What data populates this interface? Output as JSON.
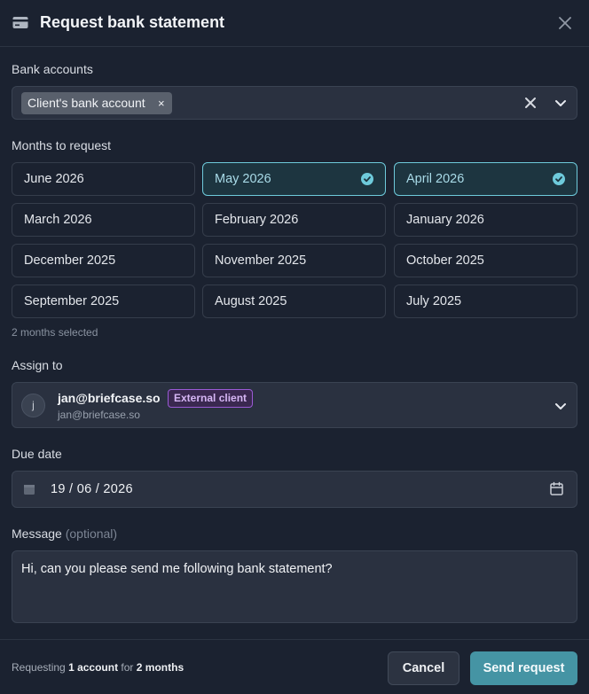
{
  "header": {
    "title": "Request bank statement"
  },
  "bank_accounts": {
    "label": "Bank accounts",
    "selected_chip": "Client's bank account",
    "chip_remove": "×"
  },
  "months": {
    "label": "Months to request",
    "items": [
      {
        "label": "June 2026",
        "selected": false
      },
      {
        "label": "May 2026",
        "selected": true
      },
      {
        "label": "April 2026",
        "selected": true
      },
      {
        "label": "March 2026",
        "selected": false
      },
      {
        "label": "February 2026",
        "selected": false
      },
      {
        "label": "January 2026",
        "selected": false
      },
      {
        "label": "December 2025",
        "selected": false
      },
      {
        "label": "November 2025",
        "selected": false
      },
      {
        "label": "October 2025",
        "selected": false
      },
      {
        "label": "September 2025",
        "selected": false
      },
      {
        "label": "August 2025",
        "selected": false
      },
      {
        "label": "July 2025",
        "selected": false
      }
    ],
    "hint": "2 months selected"
  },
  "assign": {
    "label": "Assign to",
    "avatar_initial": "j",
    "email": "jan@briefcase.so",
    "badge": "External client",
    "sub_email": "jan@briefcase.so"
  },
  "due_date": {
    "label": "Due date",
    "value": "19 / 06 / 2026"
  },
  "message": {
    "label": "Message",
    "optional": "(optional)",
    "value": "Hi, can you please send me following bank statement?"
  },
  "footer": {
    "summary_prefix": "Requesting",
    "summary_accounts": "1 account",
    "summary_mid": "for",
    "summary_months": "2 months",
    "cancel_label": "Cancel",
    "send_label": "Send request"
  },
  "colors": {
    "background": "#1b2230",
    "accent": "#4594a4",
    "selected_border": "#6ecadb",
    "badge_purple": "#9b5ad6"
  }
}
